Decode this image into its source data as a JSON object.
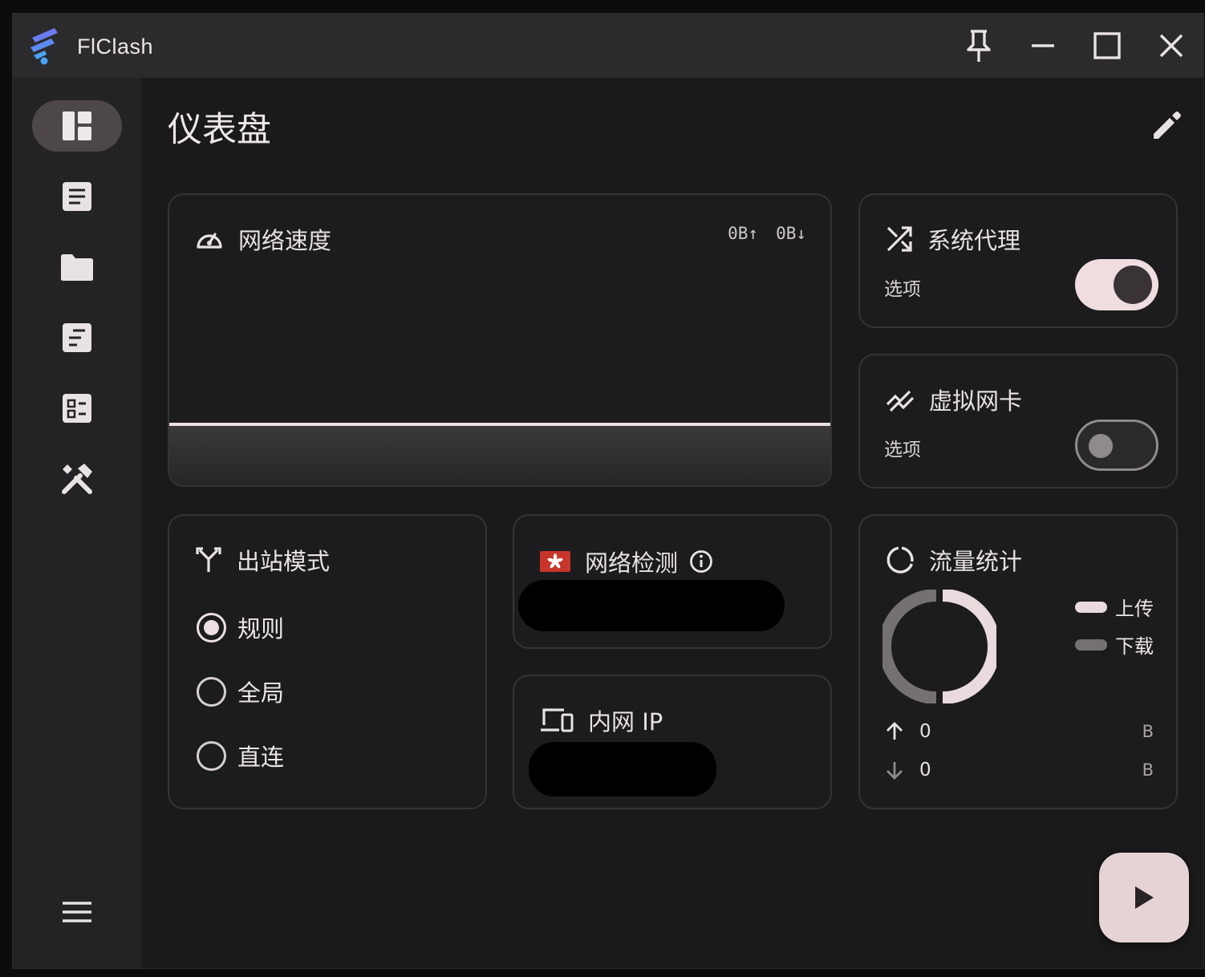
{
  "window": {
    "title": "FlClash"
  },
  "page": {
    "title": "仪表盘"
  },
  "sidebar": {
    "items": [
      {
        "name": "dashboard",
        "icon": "dashboard-icon",
        "active": true
      },
      {
        "name": "proxies",
        "icon": "article-icon"
      },
      {
        "name": "profiles",
        "icon": "folder-icon"
      },
      {
        "name": "requests",
        "icon": "list-icon"
      },
      {
        "name": "resources",
        "icon": "checklist-icon"
      },
      {
        "name": "tools",
        "icon": "tools-icon"
      }
    ],
    "menu_icon": "menu-icon"
  },
  "network_speed": {
    "title": "网络速度",
    "up": "0B↑",
    "down": "0B↓"
  },
  "system_proxy": {
    "title": "系统代理",
    "option_label": "选项",
    "enabled": true
  },
  "tun": {
    "title": "虚拟网卡",
    "option_label": "选项",
    "enabled": false
  },
  "outbound_mode": {
    "title": "出站模式",
    "options": [
      {
        "label": "规则",
        "checked": true
      },
      {
        "label": "全局",
        "checked": false
      },
      {
        "label": "直连",
        "checked": false
      }
    ]
  },
  "network_check": {
    "title": "网络检测"
  },
  "intranet_ip": {
    "title": "内网 IP"
  },
  "traffic": {
    "title": "流量统计",
    "legend": [
      {
        "label": "上传",
        "color": "#e8dadd"
      },
      {
        "label": "下载",
        "color": "#757173"
      }
    ],
    "upload": {
      "value": "0",
      "unit": "B"
    },
    "download": {
      "value": "0",
      "unit": "B"
    }
  },
  "colors": {
    "accent": "#efdde0",
    "card_border": "#353335",
    "background": "#1a191b"
  }
}
